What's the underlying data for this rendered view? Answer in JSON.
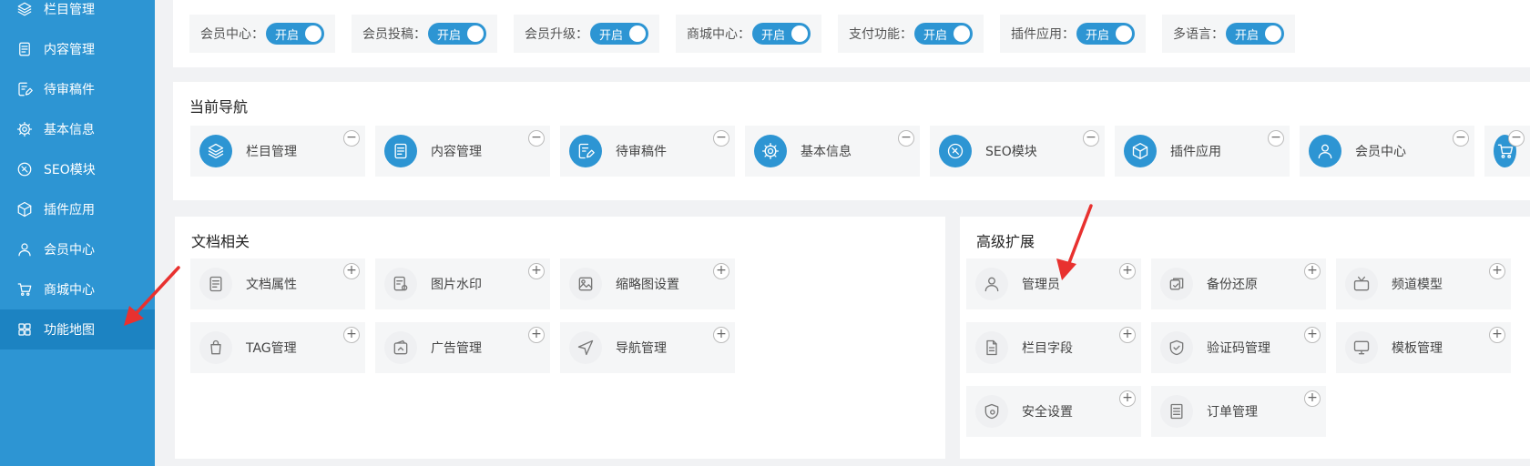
{
  "sidebar": {
    "items": [
      {
        "label": "栏目管理",
        "icon": "layers-icon"
      },
      {
        "label": "内容管理",
        "icon": "document-icon"
      },
      {
        "label": "待审稿件",
        "icon": "edit-doc-icon"
      },
      {
        "label": "基本信息",
        "icon": "gear-icon"
      },
      {
        "label": "SEO模块",
        "icon": "compass-icon"
      },
      {
        "label": "插件应用",
        "icon": "cube-icon"
      },
      {
        "label": "会员中心",
        "icon": "user-icon"
      },
      {
        "label": "商城中心",
        "icon": "cart-icon"
      },
      {
        "label": "功能地图",
        "icon": "grid-icon"
      }
    ]
  },
  "switches": {
    "state_label": "开启",
    "items": [
      {
        "label": "会员中心："
      },
      {
        "label": "会员投稿："
      },
      {
        "label": "会员升级："
      },
      {
        "label": "商城中心："
      },
      {
        "label": "支付功能："
      },
      {
        "label": "插件应用："
      },
      {
        "label": "多语言："
      }
    ]
  },
  "current_nav": {
    "title": "当前导航",
    "remove_symbol": "−",
    "items": [
      {
        "label": "栏目管理",
        "icon": "layers-icon"
      },
      {
        "label": "内容管理",
        "icon": "document-icon"
      },
      {
        "label": "待审稿件",
        "icon": "edit-doc-icon"
      },
      {
        "label": "基本信息",
        "icon": "gear-icon"
      },
      {
        "label": "SEO模块",
        "icon": "compass-icon"
      },
      {
        "label": "插件应用",
        "icon": "cube-icon"
      },
      {
        "label": "会员中心",
        "icon": "user-icon"
      },
      {
        "label": "",
        "icon": "cart-icon"
      }
    ]
  },
  "docs": {
    "title": "文档相关",
    "add_symbol": "+",
    "items": [
      {
        "label": "文档属性",
        "icon": "document-icon"
      },
      {
        "label": "图片水印",
        "icon": "watermark-icon"
      },
      {
        "label": "缩略图设置",
        "icon": "image-icon"
      },
      {
        "label": "TAG管理",
        "icon": "tag-icon"
      },
      {
        "label": "广告管理",
        "icon": "ad-icon"
      },
      {
        "label": "导航管理",
        "icon": "navigation-icon"
      }
    ]
  },
  "advanced": {
    "title": "高级扩展",
    "add_symbol": "+",
    "items": [
      {
        "label": "管理员",
        "icon": "user-icon"
      },
      {
        "label": "备份还原",
        "icon": "backup-icon"
      },
      {
        "label": "频道模型",
        "icon": "tv-icon"
      },
      {
        "label": "栏目字段",
        "icon": "field-doc-icon"
      },
      {
        "label": "验证码管理",
        "icon": "shield-check-icon"
      },
      {
        "label": "模板管理",
        "icon": "monitor-icon"
      },
      {
        "label": "安全设置",
        "icon": "shield-gear-icon"
      },
      {
        "label": "订单管理",
        "icon": "order-list-icon"
      }
    ]
  },
  "colors": {
    "accent": "#2d95d3",
    "arrow": "#e8312f"
  }
}
